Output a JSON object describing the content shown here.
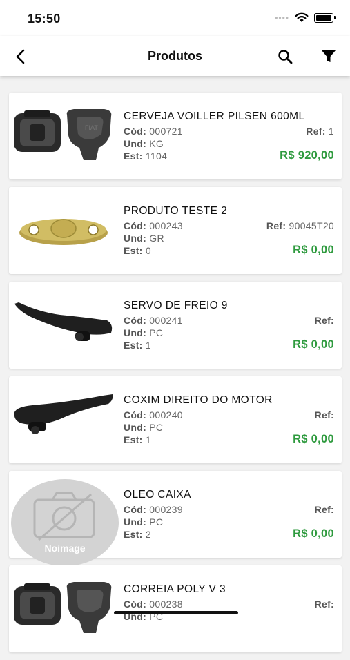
{
  "status_bar": {
    "time": "15:50"
  },
  "header": {
    "title": "Produtos"
  },
  "labels": {
    "cod": "Cód:",
    "und": "Und:",
    "est": "Est:",
    "ref": "Ref:"
  },
  "products": [
    {
      "name": "CERVEJA VOILLER PILSEN 600ML",
      "cod": "000721",
      "und": "KG",
      "est": "1104",
      "ref": "1",
      "price": "R$ 920,00",
      "image": "car-key-housing"
    },
    {
      "name": "PRODUTO TESTE 2",
      "cod": "000243",
      "und": "GR",
      "est": "0",
      "ref": "90045T20",
      "price": "R$ 0,00",
      "image": "brass-plate"
    },
    {
      "name": "SERVO DE FREIO 9",
      "cod": "000241",
      "und": "PC",
      "est": "1",
      "ref": "",
      "price": "R$ 0,00",
      "image": "door-handle"
    },
    {
      "name": "COXIM DIREITO DO MOTOR",
      "cod": "000240",
      "und": "PC",
      "est": "1",
      "ref": "",
      "price": "R$ 0,00",
      "image": "door-handle"
    },
    {
      "name": "OLEO CAIXA",
      "cod": "000239",
      "und": "PC",
      "est": "2",
      "ref": "",
      "price": "R$ 0,00",
      "image": "no-image"
    },
    {
      "name": "CORREIA POLY V 3",
      "cod": "000238",
      "und": "PC",
      "est": "",
      "ref": "",
      "price": "",
      "image": "car-key-housing"
    }
  ],
  "no_image_label": "Noimage",
  "colors": {
    "price": "#2e9a3e",
    "background": "#f2f2f2"
  }
}
